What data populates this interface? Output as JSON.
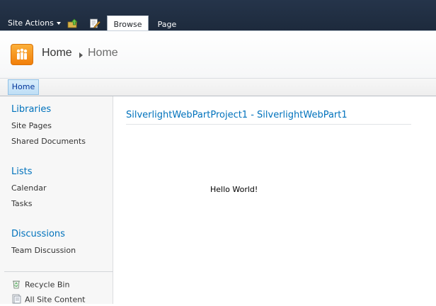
{
  "ribbon": {
    "site_actions_label": "Site Actions",
    "tabs": [
      {
        "label": "Browse",
        "selected": true
      },
      {
        "label": "Page",
        "selected": false
      }
    ],
    "icons": [
      "navigate-up-icon",
      "edit-page-icon"
    ],
    "colors": {
      "bar": "#25344a",
      "tab_text_active": "#23272c"
    }
  },
  "title_area": {
    "breadcrumb": {
      "root": "Home",
      "current": "Home"
    },
    "logo_icon": "sharepoint-site-logo-icon",
    "logo_color": "#f59a23"
  },
  "topnav": {
    "items": [
      {
        "label": "Home",
        "selected": true
      }
    ]
  },
  "quicklaunch": {
    "sections": [
      {
        "heading": "Libraries",
        "items": [
          "Site Pages",
          "Shared Documents"
        ]
      },
      {
        "heading": "Lists",
        "items": [
          "Calendar",
          "Tasks"
        ]
      },
      {
        "heading": "Discussions",
        "items": [
          "Team Discussion"
        ]
      }
    ],
    "bottom_links": [
      {
        "label": "Recycle Bin",
        "icon": "recycle-bin-icon"
      },
      {
        "label": "All Site Content",
        "icon": "site-content-icon"
      }
    ],
    "heading_color": "#0072bc"
  },
  "main": {
    "webpart_title": "SilverlightWebPartProject1 - SilverlightWebPart1",
    "content_text": "Hello World!"
  }
}
